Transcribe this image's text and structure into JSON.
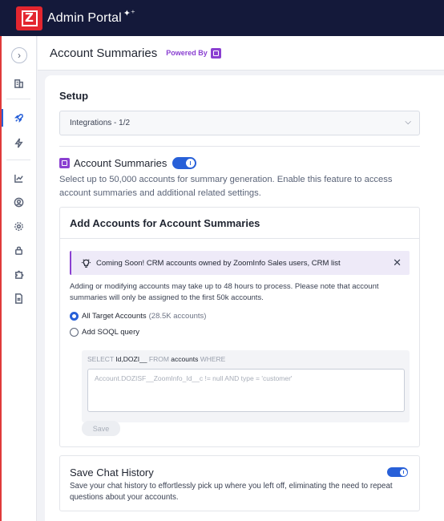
{
  "app": {
    "title": "Admin Portal"
  },
  "header": {
    "title": "Account Summaries",
    "powered_by": "Powered By"
  },
  "sidebar": {
    "items": [
      {
        "name": "building-icon",
        "active": false
      },
      {
        "name": "rocket-icon",
        "active": true
      },
      {
        "name": "bolt-icon",
        "active": false
      },
      {
        "name": "chart-icon",
        "active": false
      },
      {
        "name": "user-circle-icon",
        "active": false
      },
      {
        "name": "gear-icon",
        "active": false
      },
      {
        "name": "lock-icon",
        "active": false
      },
      {
        "name": "puzzle-icon",
        "active": false
      },
      {
        "name": "document-icon",
        "active": false
      }
    ]
  },
  "setup": {
    "title": "Setup",
    "select_value": "Integrations - 1/2"
  },
  "account_summaries": {
    "label": "Account Summaries",
    "enabled": true,
    "description": "Select up to 50,000 accounts for summary generation. Enable this feature to access account summaries and additional related settings."
  },
  "add_accounts": {
    "title": "Add Accounts for Account Summaries",
    "banner": "Coming Soon! CRM accounts owned by ZoomInfo Sales users, CRM list",
    "note": "Adding or modifying accounts may take up to 48 hours to process. Please note that account summaries will only be assigned to the first 50k accounts.",
    "option_all": "All Target Accounts",
    "option_all_count": "(28.5K accounts)",
    "option_soql": "Add SOQL query",
    "soql_select": "SELECT",
    "soql_fields": "Id,DOZI__",
    "soql_from": "FROM",
    "soql_object": "accounts",
    "soql_where": "WHERE",
    "soql_placeholder": "Account.DOZISF__ZoomInfo_Id__c != null AND type = 'customer'",
    "save_label": "Save"
  },
  "chat_history": {
    "title": "Save Chat History",
    "enabled": true,
    "description": "Save your chat history to effortlessly pick up where you left off, eliminating the need to repeat questions about your accounts."
  }
}
